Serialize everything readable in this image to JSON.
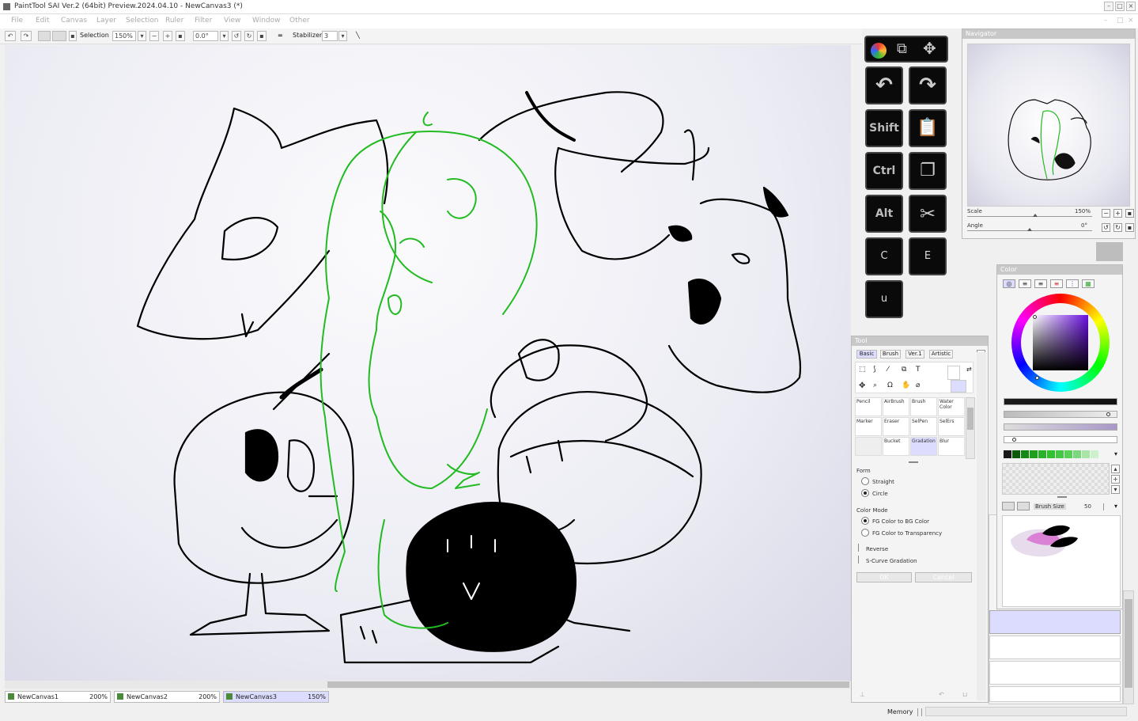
{
  "window": {
    "title": "PaintTool SAI Ver.2 (64bit) Preview.2024.04.10 - NewCanvas3 (*)"
  },
  "menu": [
    "File",
    "Edit",
    "Canvas",
    "Layer",
    "Selection",
    "Ruler",
    "Filter",
    "View",
    "Window",
    "Other"
  ],
  "toolbar": {
    "selection_label": "Selection",
    "zoom": "150%",
    "angle": "0.0°",
    "stabilizer_label": "Stabilizer",
    "stabilizer_value": "3",
    "eq": "="
  },
  "keyboard": {
    "shift": "Shift",
    "ctrl": "Ctrl",
    "alt": "Alt",
    "c": "C",
    "e": "E",
    "u": "u"
  },
  "navigator": {
    "title": "Navigator",
    "scale_label": "Scale",
    "scale_value": "150%",
    "angle_label": "Angle",
    "angle_value": "0°"
  },
  "tool": {
    "title": "Tool",
    "tabs": [
      "Basic",
      "Brush",
      "Ver.1",
      "Artistic"
    ],
    "cells": [
      {
        "name": "Pencil"
      },
      {
        "name": "AirBrush"
      },
      {
        "name": "Brush"
      },
      {
        "name": "Water Color"
      },
      {
        "name": "Marker"
      },
      {
        "name": "Eraser"
      },
      {
        "name": "SelPen"
      },
      {
        "name": "SelErs"
      },
      {
        "name": ""
      },
      {
        "name": "Bucket"
      },
      {
        "name": "Gradation"
      },
      {
        "name": "Blur"
      }
    ],
    "form_label": "Form",
    "form_options": [
      "Straight",
      "Circle"
    ],
    "color_mode_label": "Color Mode",
    "color_mode_options": [
      "FG Color to BG Color",
      "FG Color to Transparency"
    ],
    "reverse": "Reverse",
    "scurve": "S-Curve Gradation",
    "ok": "OK",
    "cancel": "Cancel"
  },
  "color": {
    "title": "Color",
    "brush_size_label": "Brush Size",
    "brush_size_value": "50",
    "swatches": [
      "#1a1a1a",
      "#0a5a0a",
      "#138a13",
      "#1ea01e",
      "#26b426",
      "#30c030",
      "#44c844",
      "#58d058",
      "#7cd87c",
      "#a8e6a8",
      "#cdf0cd"
    ]
  },
  "tabs": [
    {
      "name": "NewCanvas1",
      "zoom": "200%"
    },
    {
      "name": "NewCanvas2",
      "zoom": "200%"
    },
    {
      "name": "NewCanvas3",
      "zoom": "150%"
    }
  ],
  "status": {
    "memory_label": "Memory"
  }
}
